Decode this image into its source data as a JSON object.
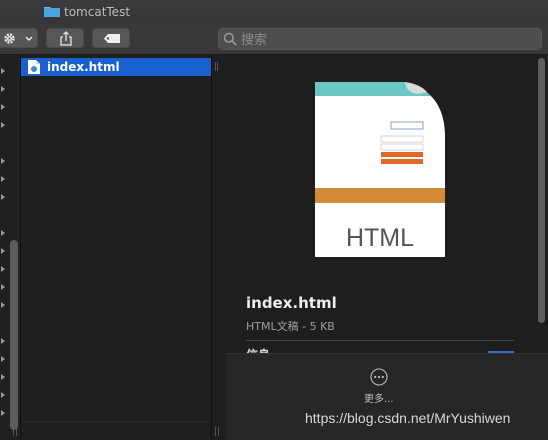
{
  "window": {
    "title": "tomcatTest"
  },
  "toolbar": {
    "search_placeholder": "搜索"
  },
  "colors": {
    "selection": "#1a5fd0",
    "accent_blue": "#2f6fd6",
    "folder": "#4aa7e0"
  },
  "file_list": {
    "items": [
      {
        "name": "index.html",
        "icon": "html-file-icon",
        "selected": true
      }
    ]
  },
  "preview": {
    "thumbnail_label": "HTML",
    "file_name": "index.html",
    "file_meta": "HTML文稿 - 5 KB",
    "info_label": "信息",
    "more_label": "更多..."
  },
  "watermark": "https://blog.csdn.net/MrYushiwen"
}
